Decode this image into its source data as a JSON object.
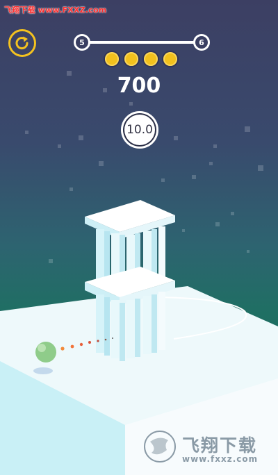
{
  "watermark_top": "飞翔下载 www.FXXZ.com",
  "hud": {
    "restart_icon": "restart-icon",
    "level_current": "5",
    "level_next": "6",
    "coins_count": 4,
    "score": "700",
    "multiplier": "10.0"
  },
  "brand": {
    "name": "飞翔下载",
    "url": "www.fxxz.com"
  },
  "colors": {
    "accent_gold": "#f2c11d",
    "sky_top": "#3c3f63",
    "sky_bottom": "#176357",
    "ground": "#eef9fb",
    "ball": "#8fcc8a"
  }
}
